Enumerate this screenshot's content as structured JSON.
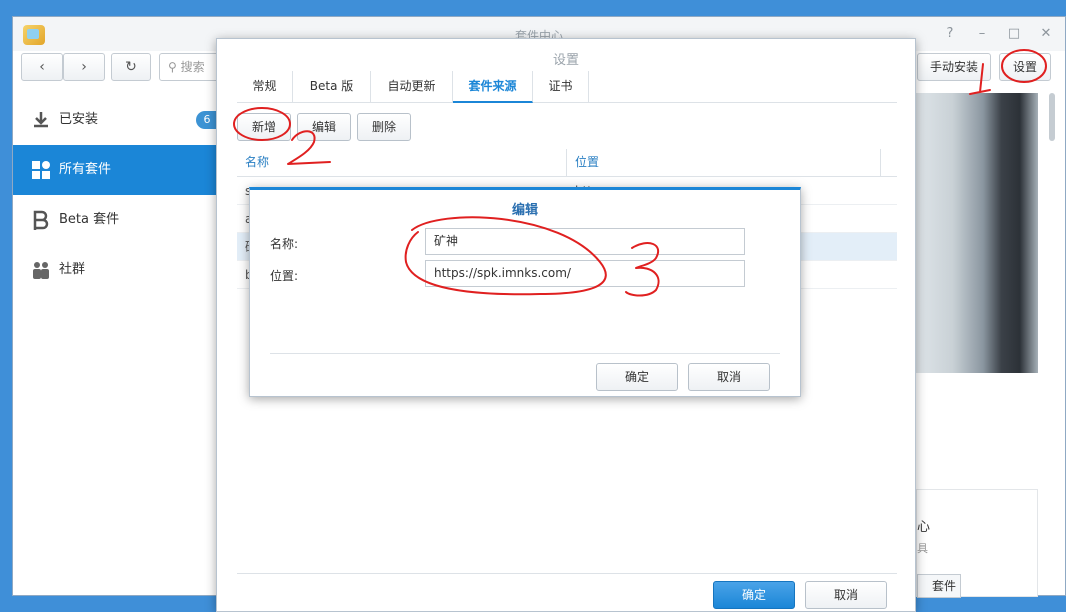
{
  "window": {
    "title": "套件中心"
  },
  "toolbar": {
    "search_placeholder": "搜索",
    "manual_install": "手动安装",
    "settings": "设置"
  },
  "sidebar": {
    "items": [
      {
        "label": "已安装",
        "badge": "6"
      },
      {
        "label": "所有套件"
      },
      {
        "label": "Beta 套件"
      },
      {
        "label": "社群"
      }
    ]
  },
  "background_card": {
    "title": "心",
    "subtitle": "具",
    "button": "套件"
  },
  "settings_dialog": {
    "title": "设置",
    "tabs": [
      "常规",
      "Beta 版",
      "自动更新",
      "套件来源",
      "证书"
    ],
    "buttons": {
      "add": "新增",
      "edit": "编辑",
      "delete": "删除"
    },
    "columns": {
      "name": "名称",
      "location": "位置"
    },
    "rows": [
      {
        "name": "s",
        "location": "http:"
      },
      {
        "name": "a",
        "location": ""
      },
      {
        "name": "矿",
        "location": ""
      },
      {
        "name": "b",
        "location": ""
      }
    ],
    "ok": "确定",
    "cancel": "取消"
  },
  "edit_dialog": {
    "title": "编辑",
    "name_label": "名称:",
    "name_value": "矿神",
    "location_label": "位置:",
    "location_value": "https://spk.imnks.com/",
    "ok": "确定",
    "cancel": "取消"
  },
  "colors": {
    "accent": "#1b86d7",
    "annotation": "#e02020",
    "desktop": "#3f8fd8"
  }
}
